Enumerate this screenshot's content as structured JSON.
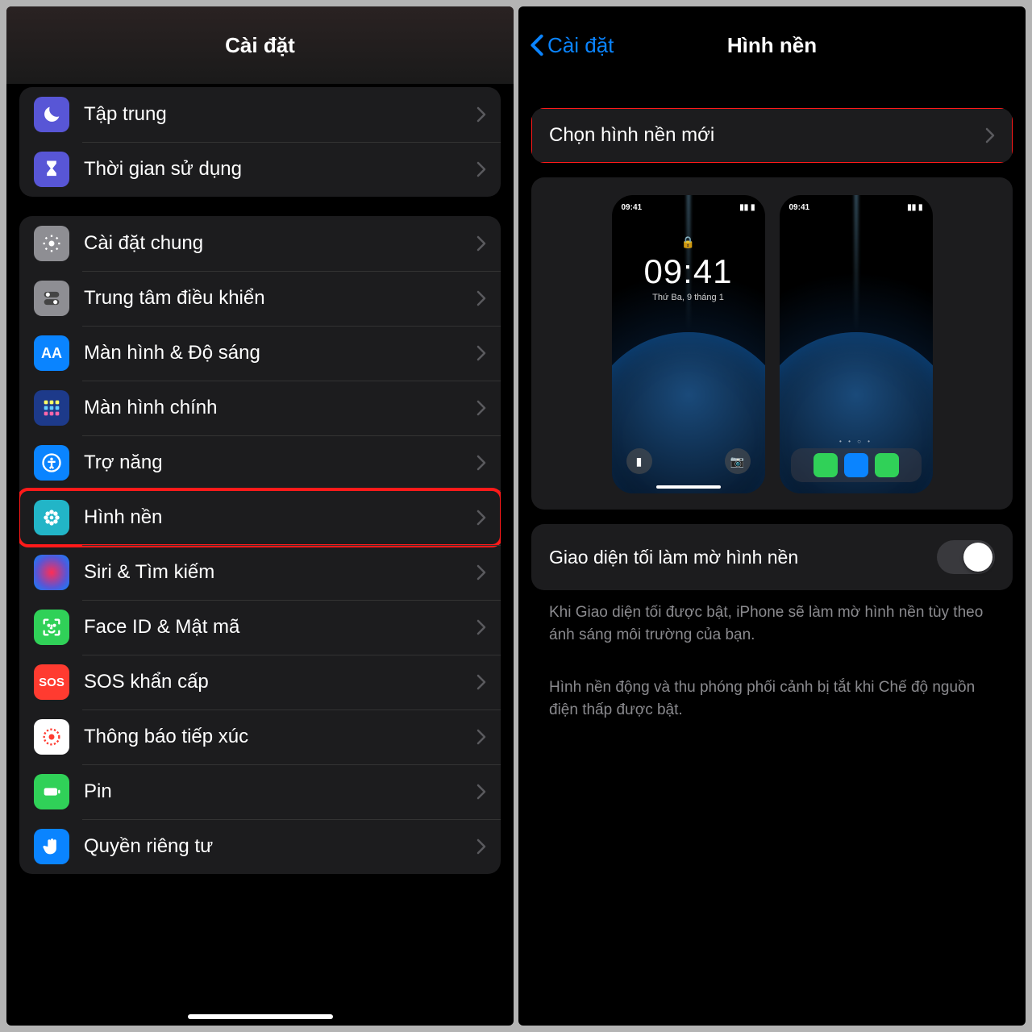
{
  "left": {
    "title": "Cài đặt",
    "group1": [
      {
        "key": "focus",
        "label": "Tập trung"
      },
      {
        "key": "screentime",
        "label": "Thời gian sử dụng"
      }
    ],
    "group2": [
      {
        "key": "general",
        "label": "Cài đặt chung"
      },
      {
        "key": "control",
        "label": "Trung tâm điều khiển"
      },
      {
        "key": "display",
        "label": "Màn hình & Độ sáng"
      },
      {
        "key": "home",
        "label": "Màn hình chính"
      },
      {
        "key": "access",
        "label": "Trợ năng"
      },
      {
        "key": "wallpaper",
        "label": "Hình nền"
      },
      {
        "key": "siri",
        "label": "Siri & Tìm kiếm"
      },
      {
        "key": "faceid",
        "label": "Face ID & Mật mã"
      },
      {
        "key": "sos",
        "label": "SOS khẩn cấp"
      },
      {
        "key": "exposure",
        "label": "Thông báo tiếp xúc"
      },
      {
        "key": "battery",
        "label": "Pin"
      },
      {
        "key": "privacy",
        "label": "Quyền riêng tư"
      }
    ],
    "sos_text": "SOS"
  },
  "right": {
    "back": "Cài đặt",
    "title": "Hình nền",
    "choose": "Chọn hình nền mới",
    "lock_time": "09:41",
    "lock_date": "Thứ Ba, 9 tháng 1",
    "status_time": "09:41",
    "toggle_label": "Giao diện tối làm mờ hình nền",
    "note1": "Khi Giao diện tối được bật, iPhone sẽ làm mờ hình nền tùy theo ánh sáng môi trường của bạn.",
    "note2": "Hình nền động và thu phóng phối cảnh bị tắt khi Chế độ nguồn điện thấp được bật."
  }
}
